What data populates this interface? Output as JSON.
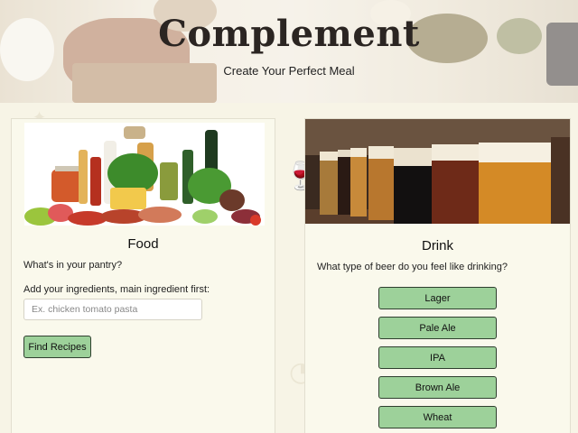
{
  "header": {
    "title": "Complement",
    "subtitle": "Create Your Perfect Meal"
  },
  "food": {
    "title": "Food",
    "prompt": "What's in your pantry?",
    "input_label": "Add your ingredients, main ingredient first:",
    "input_placeholder": "Ex. chicken tomato pasta",
    "input_value": "",
    "button_label": "Find Recipes"
  },
  "drink": {
    "title": "Drink",
    "prompt": "What type of beer do you feel like drinking?",
    "options": [
      "Lager",
      "Pale Ale",
      "IPA",
      "Brown Ale",
      "Wheat"
    ]
  },
  "colors": {
    "button_green": "#9dd19a",
    "page_background": "#f7f4e6",
    "card_background": "#faf9ec"
  }
}
